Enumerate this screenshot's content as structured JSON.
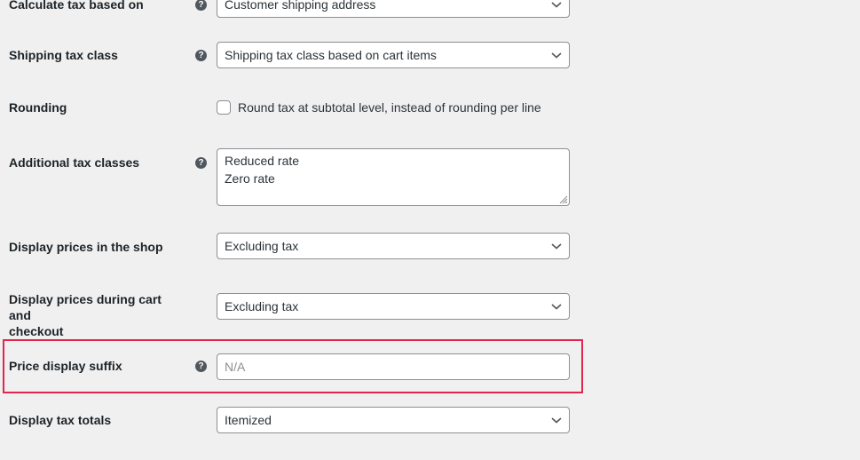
{
  "settings": {
    "calculate_tax": {
      "label": "Calculate tax based on",
      "value": "Customer shipping address",
      "icon": "help-icon"
    },
    "shipping_tax_class": {
      "label": "Shipping tax class",
      "value": "Shipping tax class based on cart items",
      "icon": "help-icon"
    },
    "rounding": {
      "label": "Rounding",
      "checkbox_label": "Round tax at subtotal level, instead of rounding per line",
      "checked": false
    },
    "additional_tax_classes": {
      "label": "Additional tax classes",
      "lines": [
        "Reduced rate",
        "Zero rate"
      ],
      "icon": "help-icon"
    },
    "display_prices_shop": {
      "label": "Display prices in the shop",
      "value": "Excluding tax"
    },
    "display_prices_cart": {
      "label_line1": "Display prices during cart and",
      "label_line2": "checkout",
      "value": "Excluding tax"
    },
    "price_display_suffix": {
      "label": "Price display suffix",
      "placeholder": "N/A",
      "value": "",
      "icon": "help-icon",
      "highlighted": true
    },
    "display_tax_totals": {
      "label": "Display tax totals",
      "value": "Itemized"
    }
  },
  "colors": {
    "background": "#f0f0f1",
    "highlight_border": "#e2264d",
    "input_border": "#8c8f94",
    "help_icon": "#50575e"
  }
}
